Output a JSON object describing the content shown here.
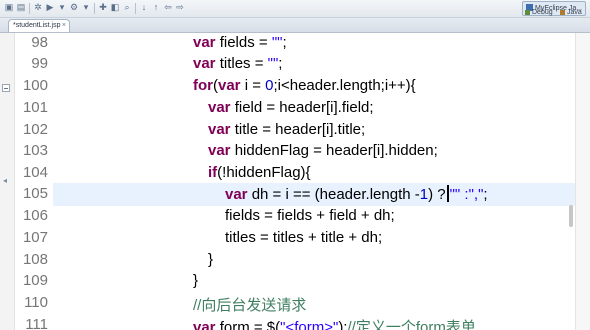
{
  "toolbar": {
    "perspectives": [
      {
        "label": "MyEclipse Ja...",
        "active": true
      },
      {
        "label": "Debug",
        "active": false
      },
      {
        "label": "Java",
        "active": false
      }
    ]
  },
  "editor_tab": {
    "label": "*studentList.jsp",
    "close": "×"
  },
  "editor": {
    "current_line": 105,
    "lines": [
      {
        "number": "98"
      },
      {
        "number": "99"
      },
      {
        "number": "100"
      },
      {
        "number": "101"
      },
      {
        "number": "102"
      },
      {
        "number": "103"
      },
      {
        "number": "104"
      },
      {
        "number": "105"
      },
      {
        "number": "106"
      },
      {
        "number": "107"
      },
      {
        "number": "108"
      },
      {
        "number": "109"
      },
      {
        "number": "110"
      },
      {
        "number": "111"
      }
    ],
    "code": {
      "l98": {
        "kw": "var",
        "rest": " fields = ",
        "str": "\"\"",
        "end": ";"
      },
      "l99": {
        "kw": "var",
        "rest": " titles = ",
        "str": "\"\"",
        "end": ";"
      },
      "l100": {
        "kw1": "for",
        "p1": "(",
        "kw2": "var",
        "p2": " i = ",
        "num": "0",
        "rest": ";i<header.length;i++){"
      },
      "l101": {
        "kw": "var",
        "rest": " field = header[i].field;"
      },
      "l102": {
        "kw": "var",
        "rest": " title = header[i].title;"
      },
      "l103": {
        "kw": "var",
        "rest": " hiddenFlag = header[i].hidden;"
      },
      "l104": {
        "kw": "if",
        "rest": "(!hiddenFlag){"
      },
      "l105": {
        "kw": "var",
        "rest": " dh = i == (header.length -",
        "num": "1",
        "rest2": ") ?",
        "str": "\"\" :\",\"",
        "end": ";"
      },
      "l106": {
        "text": "fields = fields + field + dh;"
      },
      "l107": {
        "text": "titles = titles + title + dh;"
      },
      "l108": {
        "text": "}"
      },
      "l109": {
        "text": "}"
      },
      "l110": {
        "comment": "//向后台发送请求"
      },
      "l111": {
        "kw": "var",
        "rest": " form = $(",
        "str": "\"<form>\"",
        "mid": ");",
        "comment": "//定义一个form表单"
      }
    }
  }
}
